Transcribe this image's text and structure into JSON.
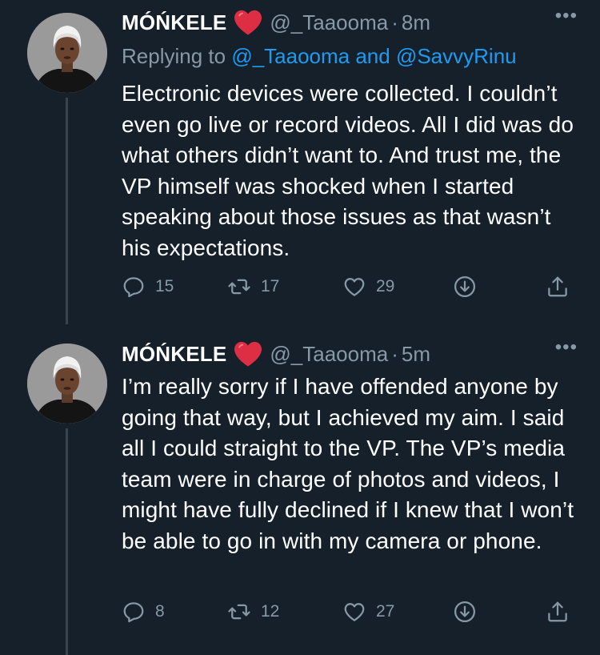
{
  "tweets": [
    {
      "author_name": "MÓŃKELE",
      "handle": "@_Taaooma",
      "separator": "·",
      "time": "8m",
      "more": "•••",
      "replying_prefix": "Replying to",
      "replying_mentions": "@_Taaooma and @SavvyRinu",
      "text": "Electronic devices were collected. I couldn’t even go live or record videos. All I did was do what others didn’t want to. And trust me, the VP himself was shocked when I started speaking about those issues as that wasn’t his expectations.",
      "replies": "15",
      "retweets": "17",
      "likes": "29"
    },
    {
      "author_name": "MÓŃKELE",
      "handle": "@_Taaooma",
      "separator": "·",
      "time": "5m",
      "more": "•••",
      "text": "I’m really sorry if I have offended anyone by going that way, but I achieved my aim. I said all I could straight to the VP. The VP’s media team were in charge of photos and videos, I might have fully declined if I knew that I won’t be able to go in with my camera or phone.",
      "replies": "8",
      "retweets": "12",
      "likes": "27"
    }
  ],
  "icons": {
    "reply": "reply-icon",
    "retweet": "retweet-icon",
    "like": "like-icon",
    "download": "download-icon",
    "share": "share-icon",
    "heart_emoji": "red-heart-emoji"
  },
  "colors": {
    "background": "#15202b",
    "secondary_text": "#8899a6",
    "link": "#1d9bf0",
    "heart": "#e0245e",
    "thread_line": "#38444d"
  }
}
